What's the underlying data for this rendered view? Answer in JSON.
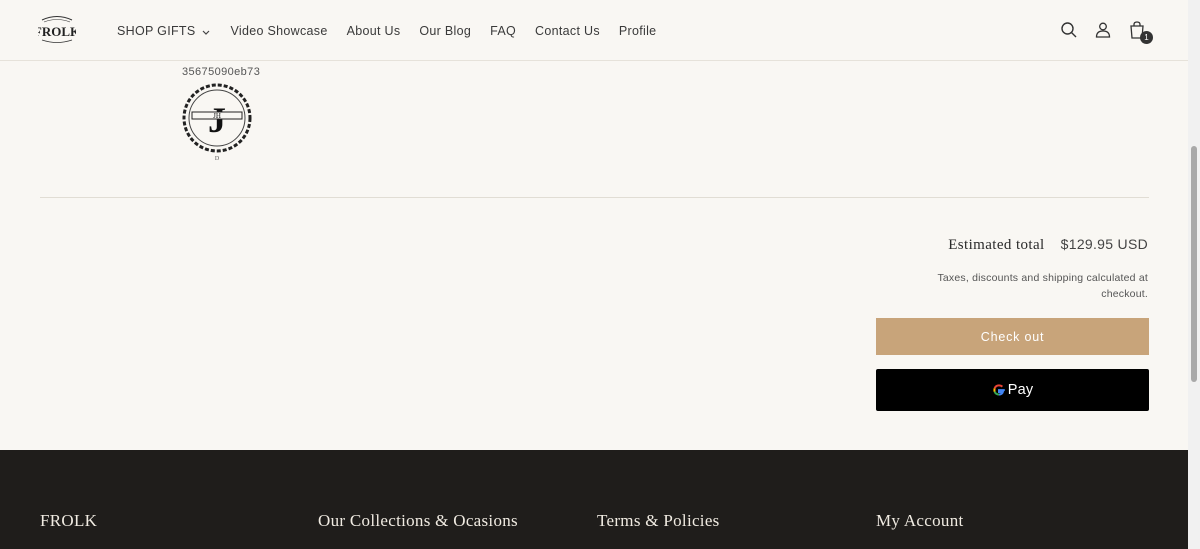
{
  "header": {
    "logo_text": "FROLK",
    "nav": [
      {
        "label": "SHOP GIFTS",
        "has_dropdown": true
      },
      {
        "label": "Video Showcase"
      },
      {
        "label": "About Us"
      },
      {
        "label": "Our Blog"
      },
      {
        "label": "FAQ"
      },
      {
        "label": "Contact Us"
      },
      {
        "label": "Profile"
      }
    ],
    "icons": [
      "search-icon",
      "account-icon",
      "cart-icon"
    ],
    "cart_count": "1"
  },
  "cart_item": {
    "id_text": "35675090eb73",
    "monogram_letter": "J",
    "monogram_initials": "JH",
    "monogram_small": "D"
  },
  "summary": {
    "total_label": "Estimated total",
    "total_value": "$129.95 USD",
    "tax_note": "Taxes, discounts and shipping calculated at checkout.",
    "checkout_label": "Check out",
    "gpay_label": "Pay"
  },
  "footer": {
    "columns": [
      "FROLK",
      "Our Collections & Ocasions",
      "Terms & Policies",
      "My Account"
    ]
  },
  "colors": {
    "background": "#f9f7f3",
    "checkout_button": "#c8a47a",
    "gpay_button": "#000000",
    "footer": "#1f1d1b"
  }
}
